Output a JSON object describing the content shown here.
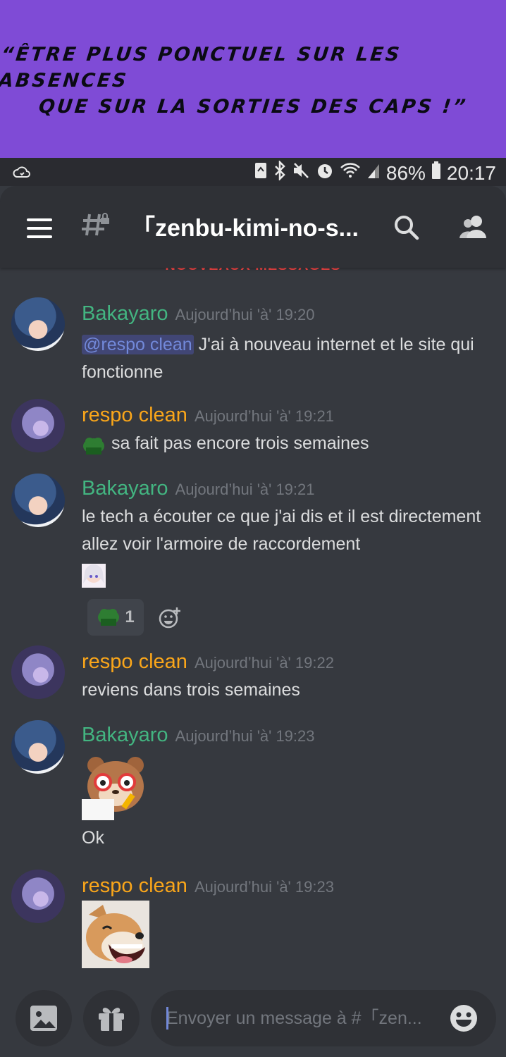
{
  "banner": {
    "line1": "“Être plus ponctuel sur les absences",
    "line2": "que sur la sorties des caps !”"
  },
  "status_bar": {
    "battery": "86%",
    "time": "20:17"
  },
  "header": {
    "channel_title": "「zenbu-kimi-no-s..."
  },
  "new_messages_label": "NOUVEAUX MESSAGES",
  "colors": {
    "bakayaro_name": "#43b581",
    "respo_name": "#faa61a",
    "accent": "#7289da"
  },
  "messages": [
    {
      "author": "Bakayaro",
      "timestamp": "Aujourd’hui 'à' 19:20",
      "mention": "@respo clean",
      "text": " J'ai à nouveau internet et le site qui fonctionne"
    },
    {
      "author": "respo clean",
      "timestamp": "Aujourd’hui 'à' 19:21",
      "emoji": "pepe-emoji",
      "text": "sa fait pas encore trois semaines"
    },
    {
      "author": "Bakayaro",
      "timestamp": "Aujourd’hui 'à' 19:21",
      "text": "le tech a écouter ce que j'ai dis et il est directement allez voir l'armoire de raccordement",
      "reaction_count": "1"
    },
    {
      "author": "respo clean",
      "timestamp": "Aujourd’hui 'à' 19:22",
      "text": "reviens dans trois semaines"
    },
    {
      "author": "Bakayaro",
      "timestamp": "Aujourd’hui 'à' 19:23",
      "sticker": "bear-glasses-sticker",
      "text": "Ok"
    },
    {
      "author": "respo clean",
      "timestamp": "Aujourd’hui 'à' 19:23",
      "sticker": "dog-laughing-sticker"
    }
  ],
  "composer": {
    "placeholder": "Envoyer un message à #「zen..."
  }
}
